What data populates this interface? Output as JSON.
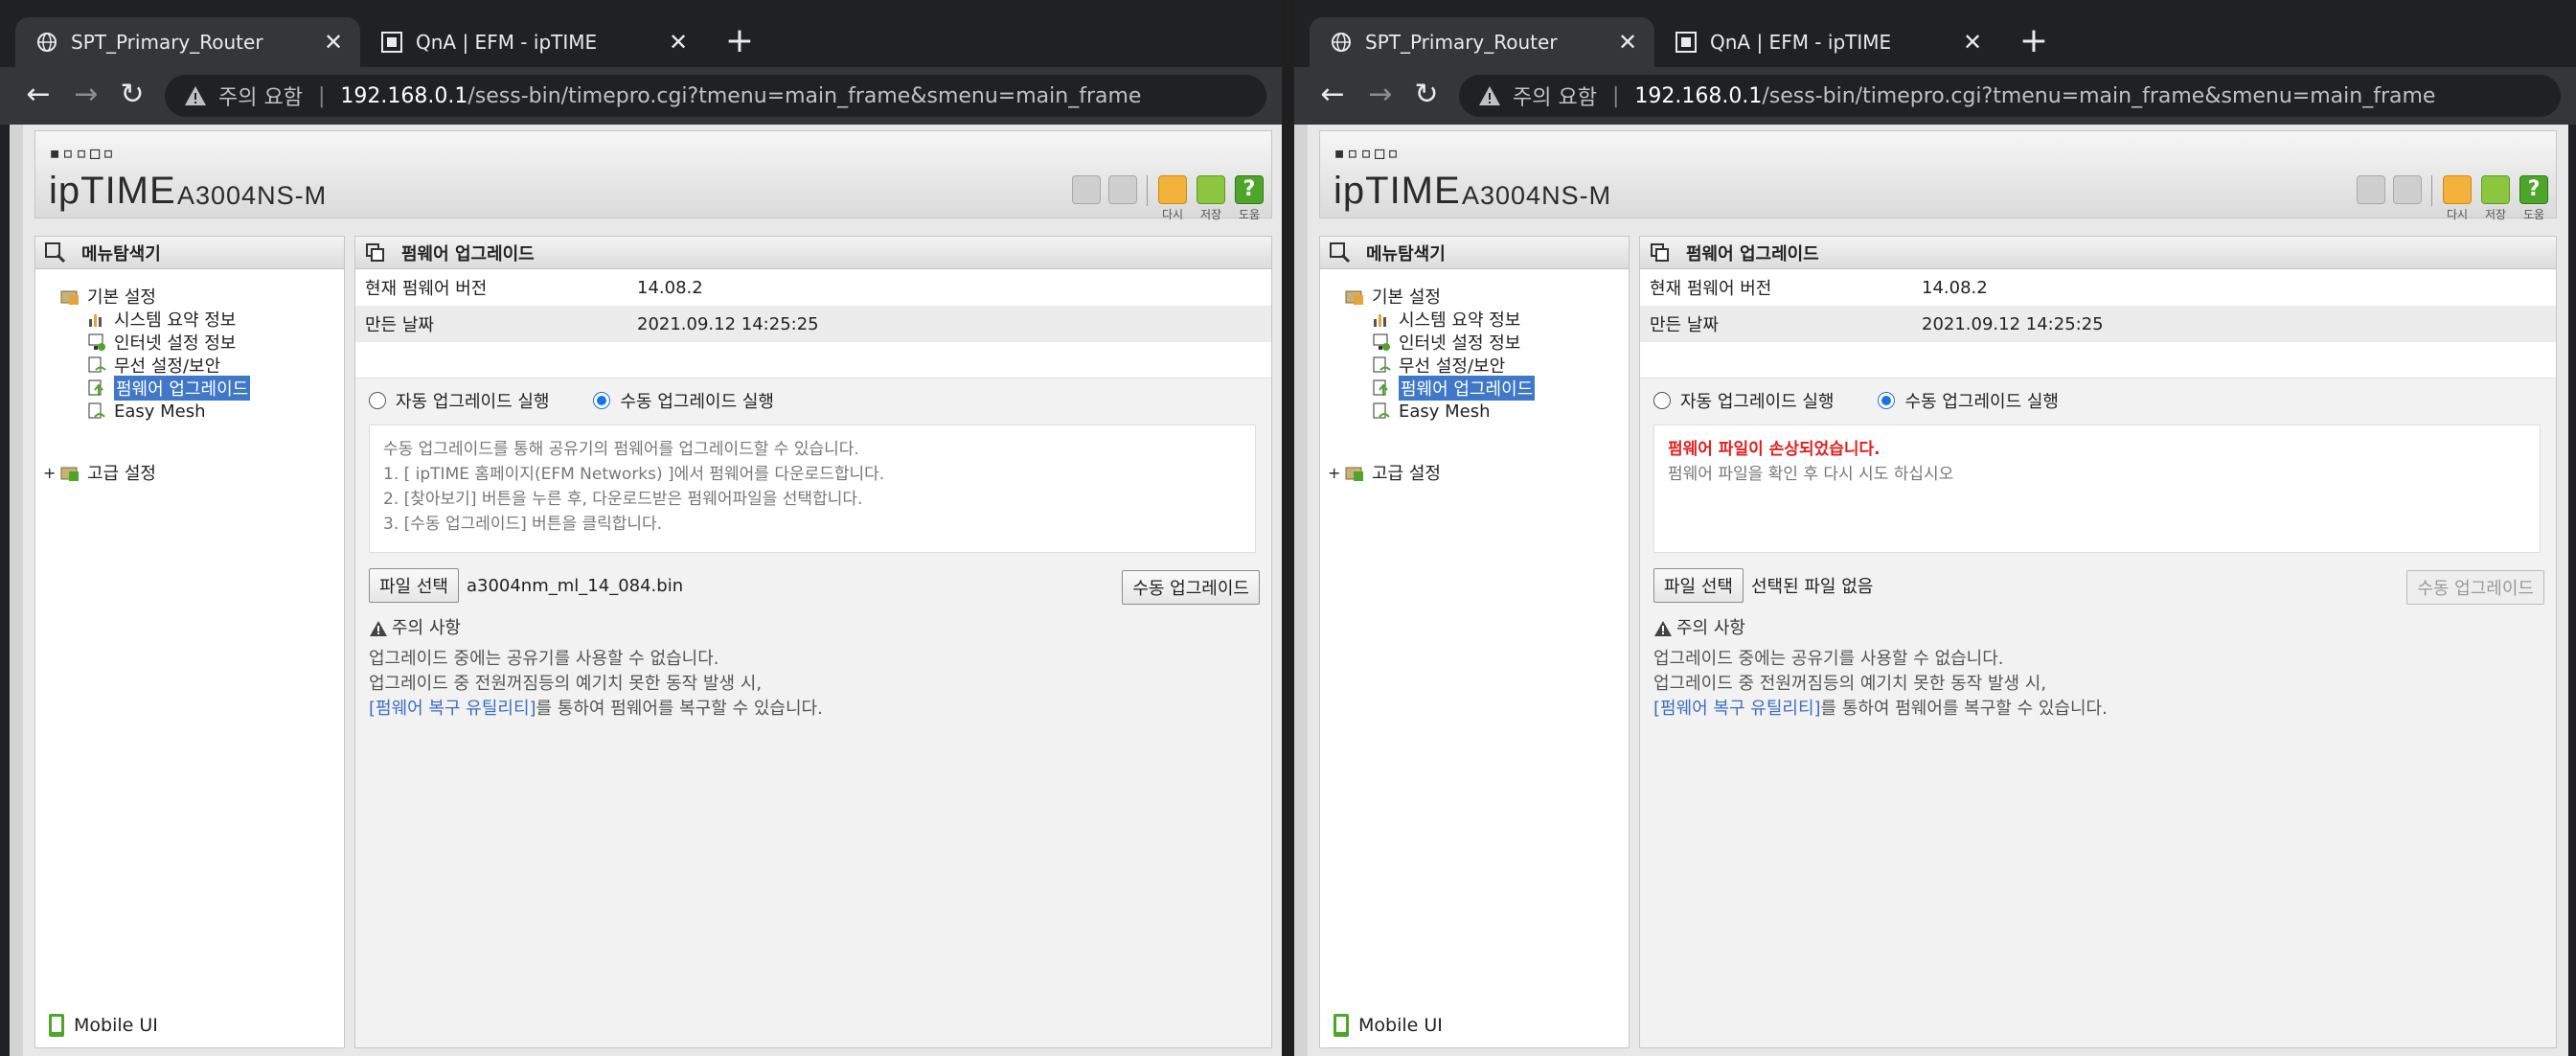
{
  "browser_left": {
    "tabs": [
      {
        "title": "SPT_Primary_Router",
        "active": true
      },
      {
        "title": "QnA | EFM - ipTIME",
        "active": false
      }
    ],
    "address": {
      "security_label": "주의 요함",
      "host": "192.168.0.1",
      "path": "/sess-bin/timepro.cgi?tmenu=main_frame&smenu=main_frame"
    }
  },
  "browser_right": {
    "tabs": [
      {
        "title": "SPT_Primary_Router",
        "active": true
      },
      {
        "title": "QnA | EFM - ipTIME",
        "active": false
      }
    ],
    "address": {
      "security_label": "주의 요함",
      "host": "192.168.0.1",
      "path": "/sess-bin/timepro.cgi?tmenu=main_frame&smenu=main_frame"
    }
  },
  "header": {
    "logo_dots": "▪▫▫◻▫",
    "logo_brand": "ipTIME",
    "model": "A3004NS-M",
    "btn_labels": [
      "다시",
      "저장",
      "도움"
    ]
  },
  "sidebar": {
    "title": "메뉴탐색기",
    "groups": [
      {
        "label": "기본 설정"
      },
      {
        "label": "고급 설정"
      }
    ],
    "items": [
      {
        "label": "시스템 요약 정보"
      },
      {
        "label": "인터넷 설정 정보"
      },
      {
        "label": "무선 설정/보안"
      },
      {
        "label": "펌웨어 업그레이드",
        "selected": true
      },
      {
        "label": "Easy Mesh"
      }
    ],
    "mobile_label": "Mobile UI"
  },
  "main": {
    "title": "펌웨어 업그레이드",
    "version_label": "현재 펌웨어 버전",
    "version_value": "14.08.2",
    "date_label": "만든 날짜",
    "date_value": "2021.09.12 14:25:25",
    "radio_auto": "자동 업그레이드 실행",
    "radio_manual": "수동 업그레이드 실행",
    "upgrade_button": "수동 업그레이드",
    "file_button": "파일 선택",
    "caution_title": "주의 사항",
    "caution_line1": "업그레이드 중에는 공유기를 사용할 수 없습니다.",
    "caution_line2": "업그레이드 중 전원꺼짐등의 예기치 못한 동작 발생 시,",
    "caution_link": "[펌웨어 복구 유틸리티]",
    "caution_line3_rest": "를 통하여 펌웨어를 복구할 수 있습니다."
  },
  "left_panel": {
    "instructions": [
      "수동 업그레이드를 통해 공유기의 펌웨어를 업그레이드할 수 있습니다.",
      "1. [ ipTIME 홈페이지(EFM Networks) ]에서 펌웨어를 다운로드합니다.",
      "2. [찾아보기] 버튼을 누른 후, 다운로드받은 펌웨어파일을 선택합니다.",
      "3. [수동 업그레이드] 버튼을 클릭합니다."
    ],
    "file_name": "a3004nm_ml_14_084.bin"
  },
  "right_panel": {
    "error_title": "펌웨어 파일이 손상되었습니다.",
    "error_detail": "펌웨어 파일을 확인 후 다시 시도 하십시오",
    "file_name": "선택된 파일 없음"
  },
  "colors": {
    "selected_item": "#3f78c8",
    "error": "#e02020",
    "link": "#3a6fc4",
    "radio_on": "#1a73e8"
  }
}
